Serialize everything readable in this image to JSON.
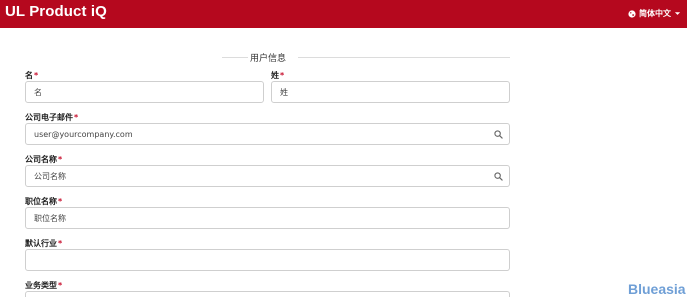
{
  "header": {
    "brand": "UL Product iQ",
    "language": "简体中文",
    "globe_icon": "globe-icon",
    "caret_icon": "caret-down-icon"
  },
  "form": {
    "section_title": "用户信息",
    "required_mark": "*",
    "first_name": {
      "label": "名",
      "value": "名"
    },
    "last_name": {
      "label": "姓",
      "value": "姓"
    },
    "email": {
      "label": "公司电子邮件",
      "value": "user@yourcompany.com",
      "icon": "search-icon"
    },
    "company": {
      "label": "公司名称",
      "value": "公司名称",
      "icon": "search-icon"
    },
    "job_title": {
      "label": "职位名称",
      "value": "职位名称"
    },
    "industry": {
      "label": "默认行业",
      "value": ""
    },
    "business_type": {
      "label": "业务类型"
    }
  },
  "watermark": "Blueasia",
  "colors": {
    "brand_red": "#b5081e",
    "required_red": "#c8102e",
    "watermark_blue": "#6f9fd6"
  }
}
